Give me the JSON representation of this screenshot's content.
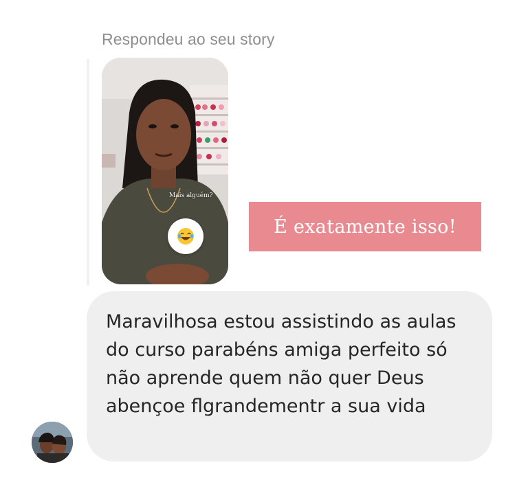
{
  "story_reply": {
    "caption": "Respondeu ao seu story",
    "story_overlay_text": "Mais alguém?",
    "reaction_emoji": "😂"
  },
  "sticker": {
    "text": "É exatamente isso!",
    "color": "#e98a91"
  },
  "message": {
    "text": "Maravilhosa estou assistindo as aulas do curso parabéns amiga perfeito só não aprende quem não quer Deus abençoe flgrandementr a sua vida",
    "bubble_color": "#efefef"
  },
  "avatar": {
    "icon": "user-avatar-photo"
  }
}
